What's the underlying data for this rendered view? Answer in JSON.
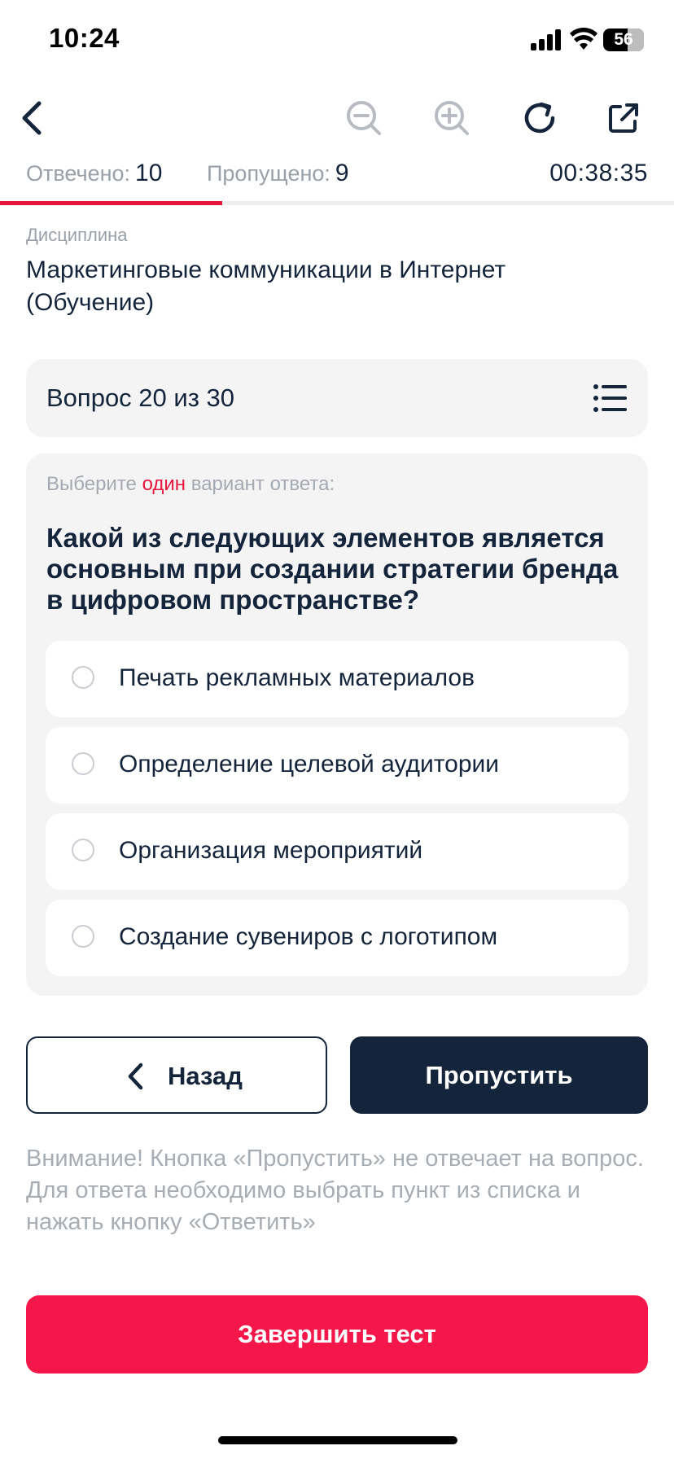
{
  "status_bar": {
    "time": "10:24",
    "battery": "56"
  },
  "toolbar": {
    "icons": [
      "back-chevron-icon",
      "zoom-out-icon",
      "zoom-in-icon",
      "refresh-icon",
      "external-link-icon"
    ]
  },
  "stats": {
    "answered_label": "Отвечено:",
    "answered_value": "10",
    "skipped_label": "Пропущено:",
    "skipped_value": "9",
    "timer": "00:38:35",
    "progress_fraction": 0.33
  },
  "discipline": {
    "label": "Дисциплина",
    "title": "Маркетинговые коммуникации в Интернет (Обучение)"
  },
  "question_header": {
    "text": "Вопрос 20 из 30"
  },
  "question": {
    "instruction_prefix": "Выберите ",
    "instruction_accent": "один",
    "instruction_suffix": " вариант ответа:",
    "text": "Какой из следующих элементов является основным при создании стратегии бренда в цифровом пространстве?",
    "options": [
      "Печать рекламных материалов",
      "Определение целевой аудитории",
      "Организация мероприятий",
      "Создание сувениров с логотипом"
    ]
  },
  "buttons": {
    "back_label": "Назад",
    "skip_label": "Пропустить",
    "finish_label": "Завершить тест"
  },
  "notice": "Внимание! Кнопка «Пропустить» не отвечает на вопрос. Для ответа необходимо выбрать пункт из списка и нажать кнопку «Ответить»",
  "colors": {
    "accent": "#e8163d",
    "primary_dark": "#14243a",
    "finish_button": "#f5174a",
    "card_bg": "#f4f4f5"
  }
}
